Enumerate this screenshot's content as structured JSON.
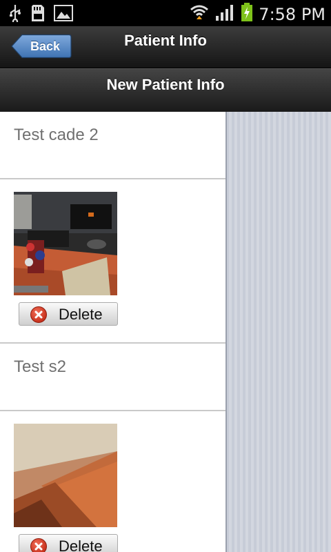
{
  "status_bar": {
    "time": "7:58 PM",
    "icons": [
      "usb-icon",
      "sd-card-icon",
      "image-icon",
      "wifi-icon",
      "signal-icon",
      "battery-charging-icon"
    ]
  },
  "header": {
    "back_label": "Back",
    "title": "Patient Info"
  },
  "subheader": {
    "title": "New Patient Info"
  },
  "list": {
    "items": [
      {
        "type": "text",
        "text": "Test cade 2"
      },
      {
        "type": "image",
        "image": "desk-photo",
        "delete_label": "Delete"
      },
      {
        "type": "text",
        "text": "Test s2"
      },
      {
        "type": "image",
        "image": "table-photo",
        "delete_label": "Delete"
      }
    ]
  },
  "colors": {
    "back_button": "#4f86c6",
    "delete_icon": "#d33d26",
    "background_stripes": "#c7ccd7"
  }
}
